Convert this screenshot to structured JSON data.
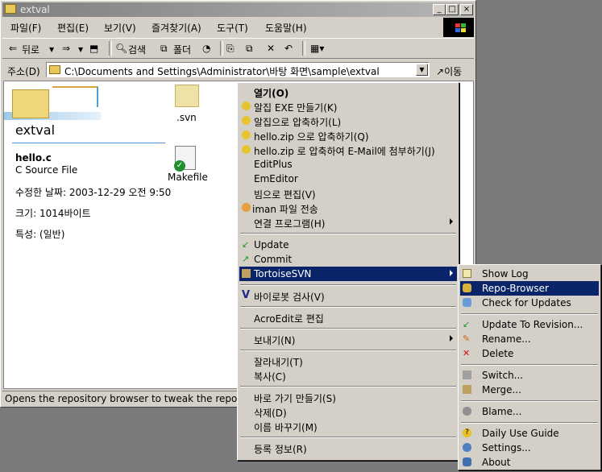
{
  "window": {
    "title": "extval",
    "minimize": "_",
    "maximize": "□",
    "close": "×"
  },
  "menubar": [
    "파일(F)",
    "편집(E)",
    "보기(V)",
    "즐겨찾기(A)",
    "도구(T)",
    "도움말(H)"
  ],
  "toolbar": {
    "back": "뒤로",
    "search": "검색",
    "folders": "폴더"
  },
  "address": {
    "label": "주소(D)",
    "value": "C:\\Documents and Settings\\Administrator\\바탕 화면\\sample\\extval",
    "go": "이동"
  },
  "leftpane": {
    "folder_name": "extval",
    "file_name": "hello.c",
    "file_type": "C Source File",
    "modified": "수정한 날짜: 2003-12-29 오전 9:50",
    "size": "크기: 1014바이트",
    "attributes": "특성: (일반)"
  },
  "files": [
    ".svn",
    "Makefile"
  ],
  "status": "Opens the repository browser to tweak the reposito",
  "context_menu": [
    {
      "label": "열기(O)",
      "bold": true
    },
    {
      "label": "알집 EXE 만들기(K)"
    },
    {
      "label": "알집으로 압축하기(L)"
    },
    {
      "label": "hello.zip 으로 압축하기(Q)"
    },
    {
      "label": "hello.zip 로 압축하여 E-Mail에 첨부하기(J)"
    },
    {
      "label": "EditPlus"
    },
    {
      "label": "EmEditor"
    },
    {
      "label": "빔으로 편집(V)"
    },
    {
      "label": "iman 파일 전송"
    },
    {
      "label": "연결 프로그램(H)"
    },
    {
      "label": "Update"
    },
    {
      "label": "Commit"
    },
    {
      "label": "TortoiseSVN"
    },
    {
      "label": "바이로봇 검사(V)"
    },
    {
      "label": "AcroEdit로 편집"
    },
    {
      "label": "보내기(N)"
    },
    {
      "label": "잘라내기(T)"
    },
    {
      "label": "복사(C)"
    },
    {
      "label": "바로 가기 만들기(S)"
    },
    {
      "label": "삭제(D)"
    },
    {
      "label": "이름 바꾸기(M)"
    },
    {
      "label": "등록 정보(R)"
    }
  ],
  "submenu": [
    {
      "label": "Show Log"
    },
    {
      "label": "Repo-Browser"
    },
    {
      "label": "Check for Updates"
    },
    {
      "label": "Update To Revision..."
    },
    {
      "label": "Rename..."
    },
    {
      "label": "Delete"
    },
    {
      "label": "Switch..."
    },
    {
      "label": "Merge..."
    },
    {
      "label": "Blame..."
    },
    {
      "label": "Daily Use Guide"
    },
    {
      "label": "Settings..."
    },
    {
      "label": "About"
    }
  ],
  "colors": {
    "selection": "#0a246a",
    "face": "#d4d0c8",
    "desktop": "#7b7b7b"
  }
}
